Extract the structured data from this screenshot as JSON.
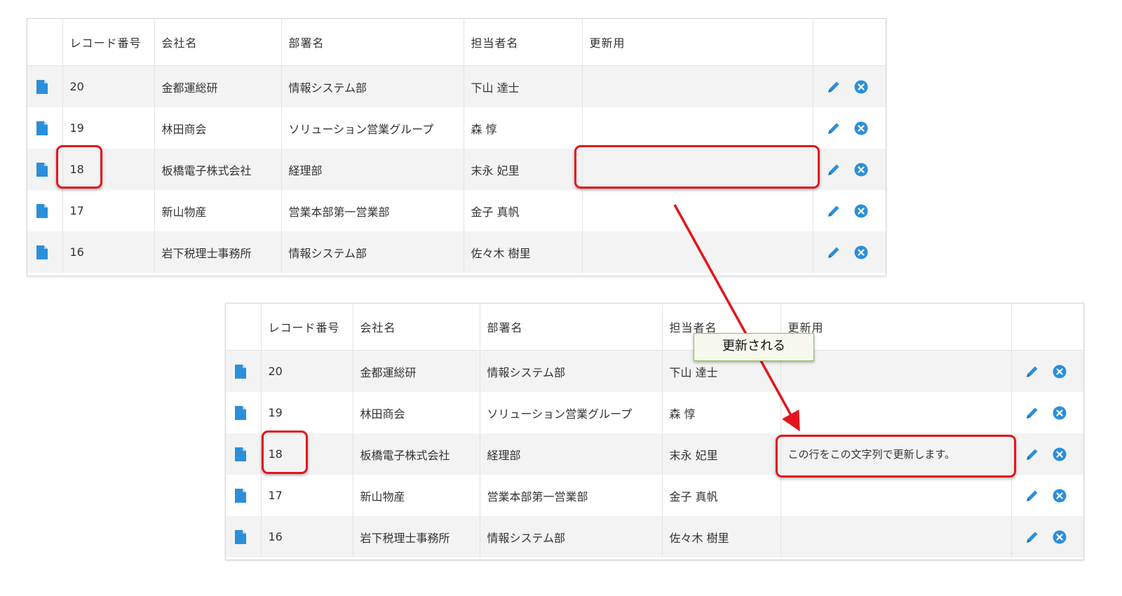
{
  "headers": [
    "",
    "レコード番号",
    "会社名",
    "部署名",
    "担当者名",
    "更新用",
    ""
  ],
  "before_rows": [
    {
      "record": "20",
      "company": "金都運総研",
      "dept": "情報システム部",
      "person": "下山 達士",
      "update": ""
    },
    {
      "record": "19",
      "company": "林田商会",
      "dept": "ソリューション営業グループ",
      "person": "森 惇",
      "update": ""
    },
    {
      "record": "18",
      "company": "板橋電子株式会社",
      "dept": "経理部",
      "person": "末永 妃里",
      "update": ""
    },
    {
      "record": "17",
      "company": "新山物産",
      "dept": "営業本部第一営業部",
      "person": "金子 真帆",
      "update": ""
    },
    {
      "record": "16",
      "company": "岩下税理士事務所",
      "dept": "情報システム部",
      "person": "佐々木 樹里",
      "update": ""
    }
  ],
  "after_rows": [
    {
      "record": "20",
      "company": "金都運総研",
      "dept": "情報システム部",
      "person": "下山 達士",
      "update": ""
    },
    {
      "record": "19",
      "company": "林田商会",
      "dept": "ソリューション営業グループ",
      "person": "森 惇",
      "update": ""
    },
    {
      "record": "18",
      "company": "板橋電子株式会社",
      "dept": "経理部",
      "person": "末永 妃里",
      "update": "この行をこの文字列で更新します。"
    },
    {
      "record": "17",
      "company": "新山物産",
      "dept": "営業本部第一営業部",
      "person": "金子 真帆",
      "update": ""
    },
    {
      "record": "16",
      "company": "岩下税理士事務所",
      "dept": "情報システム部",
      "person": "佐々木 樹里",
      "update": ""
    }
  ],
  "callout_text": "更新される",
  "icons": {
    "row": "document-icon",
    "edit": "pencil-icon",
    "delete": "close-circle-icon"
  },
  "colors": {
    "accent": "#2b8fd9",
    "highlight": "#e4141c",
    "callout_border": "#8fbf5e",
    "callout_bg": "#f7f9ee"
  }
}
